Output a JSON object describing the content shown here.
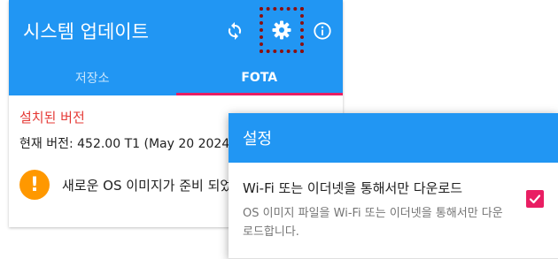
{
  "app": {
    "title": "시스템 업데이트",
    "toolbar_icons": [
      "sync-icon",
      "gear-icon",
      "info-icon"
    ],
    "tabs": [
      {
        "label": "저장소",
        "selected": false
      },
      {
        "label": "FOTA",
        "selected": true
      }
    ],
    "section_title": "설치된 버전",
    "current_version": "현재 버전: 452.00 T1 (May 20 2024)",
    "notice": {
      "icon": "warning-icon",
      "text": "새로운 OS 이미지가 준비 되었"
    }
  },
  "settings_dialog": {
    "title": "설정",
    "preference": {
      "title": "Wi-Fi 또는 이더넷을 통해서만 다운로드",
      "summary": "OS 이미지 파일을 Wi-Fi 또는 이더넷을 통해서만 다운로드합니다.",
      "checked": true
    }
  },
  "colors": {
    "primary": "#2196f3",
    "accent": "#e91e63",
    "section_title": "#e53935",
    "warning": "#ff9800",
    "highlight": "#8b1010"
  }
}
